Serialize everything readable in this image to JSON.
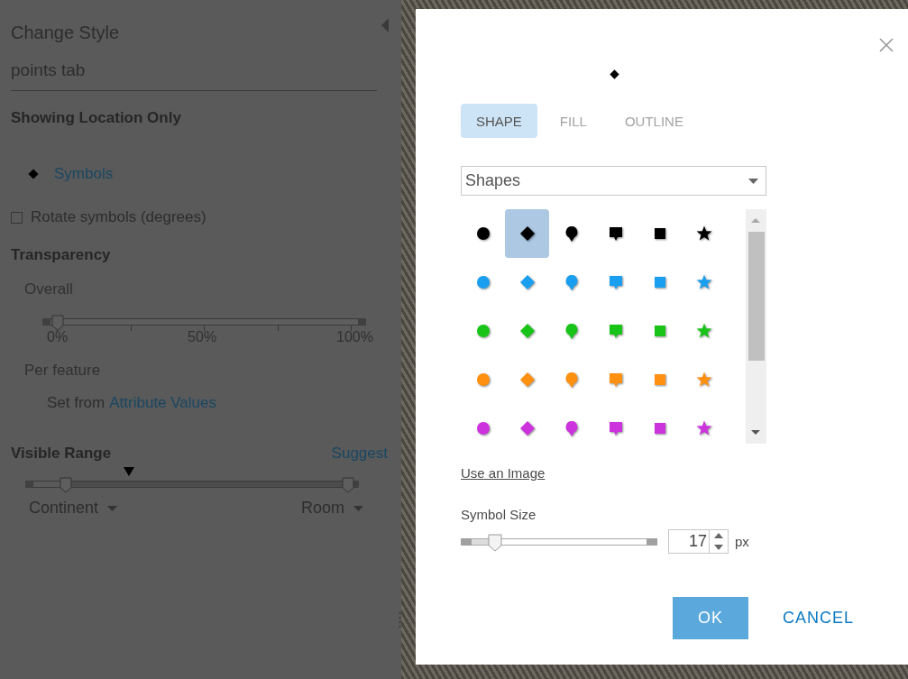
{
  "panel": {
    "title": "Change Style",
    "subtitle": "points tab",
    "heading": "Showing Location Only",
    "symbols_link": "Symbols",
    "rotate_checkbox": {
      "label": "Rotate symbols (degrees)",
      "checked": false
    },
    "transparency": {
      "heading": "Transparency",
      "overall_label": "Overall",
      "level": 0,
      "tick_labels": [
        "0%",
        "50%",
        "100%"
      ],
      "per_feature_label": "Per feature",
      "set_from_text": "Set from",
      "attribute_link": "Attribute Values"
    },
    "visible_range": {
      "heading": "Visible Range",
      "suggest_link": "Suggest",
      "min_thumb": {
        "level": 0.12
      },
      "max_thumb": {
        "level": 0.97
      },
      "current_marker": {
        "level": 0.31
      },
      "min_scale": "Continent",
      "max_scale": "Room"
    }
  },
  "dialog": {
    "tabs": [
      {
        "label": "SHAPE",
        "selected": true
      },
      {
        "label": "FILL",
        "selected": false
      },
      {
        "label": "OUTLINE",
        "selected": false
      }
    ],
    "dropdown": {
      "value": "Shapes"
    },
    "symbol_rows": [
      {
        "color": "#000000",
        "symbols": [
          {
            "kind": "circle",
            "selected": false
          },
          {
            "kind": "diamond",
            "selected": true
          },
          {
            "kind": "pin",
            "selected": false
          },
          {
            "kind": "callout",
            "selected": false
          },
          {
            "kind": "square",
            "selected": false
          },
          {
            "kind": "star",
            "selected": false
          }
        ]
      },
      {
        "color": "#1a9ff0",
        "symbols": [
          {
            "kind": "circle",
            "selected": false
          },
          {
            "kind": "diamond",
            "selected": false
          },
          {
            "kind": "pin",
            "selected": false
          },
          {
            "kind": "callout",
            "selected": false
          },
          {
            "kind": "square",
            "selected": false
          },
          {
            "kind": "star",
            "selected": false
          }
        ]
      },
      {
        "color": "#18c418",
        "symbols": [
          {
            "kind": "circle",
            "selected": false
          },
          {
            "kind": "diamond",
            "selected": false
          },
          {
            "kind": "pin",
            "selected": false
          },
          {
            "kind": "callout",
            "selected": false
          },
          {
            "kind": "square",
            "selected": false
          },
          {
            "kind": "star",
            "selected": false
          }
        ]
      },
      {
        "color": "#ff9010",
        "symbols": [
          {
            "kind": "circle",
            "selected": false
          },
          {
            "kind": "diamond",
            "selected": false
          },
          {
            "kind": "pin",
            "selected": false
          },
          {
            "kind": "callout",
            "selected": false
          },
          {
            "kind": "square",
            "selected": false
          },
          {
            "kind": "star",
            "selected": false
          }
        ]
      },
      {
        "color": "#cc33dd",
        "symbols": [
          {
            "kind": "circle",
            "selected": false
          },
          {
            "kind": "diamond",
            "selected": false
          },
          {
            "kind": "pin",
            "selected": false
          },
          {
            "kind": "callout",
            "selected": false
          },
          {
            "kind": "square",
            "selected": false
          },
          {
            "kind": "star",
            "selected": false
          }
        ]
      }
    ],
    "image_link": "Use an Image",
    "size": {
      "label": "Symbol Size",
      "level": 0.17,
      "value": "17",
      "unit": "px"
    },
    "buttons": [
      {
        "label": "OK",
        "kind": "primary"
      },
      {
        "label": "CANCEL",
        "kind": "link"
      }
    ]
  }
}
